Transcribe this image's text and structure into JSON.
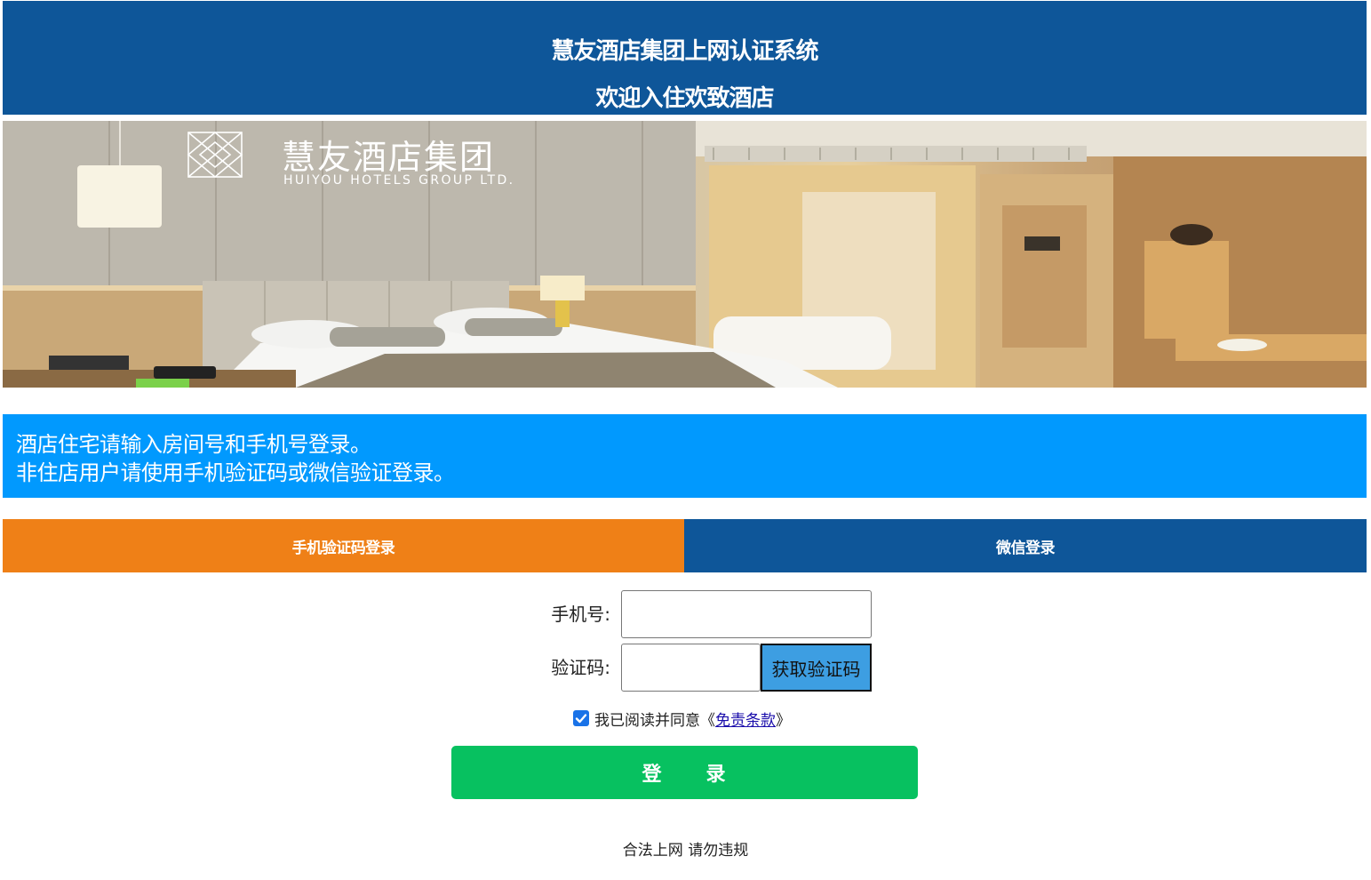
{
  "header": {
    "title": "慧友酒店集团上网认证系统",
    "subtitle": "欢迎入住欢致酒店"
  },
  "banner": {
    "brand_name": "慧友酒店集团",
    "brand_en": "HUIYOU HOTELS GROUP LTD."
  },
  "notice": {
    "line1": "酒店住宅请输入房间号和手机号登录。",
    "line2": "非住店用户请使用手机验证码或微信验证登录。"
  },
  "tabs": [
    {
      "label": "手机验证码登录",
      "active": true
    },
    {
      "label": "微信登录",
      "active": false
    }
  ],
  "form": {
    "phone_label": "手机号:",
    "phone_value": "",
    "code_label": "验证码:",
    "code_value": "",
    "get_code_label": "获取验证码",
    "agree_checked": true,
    "agree_text": "我已阅读并同意《",
    "agree_link": "免责条款",
    "agree_suffix": "》",
    "login_label": "登　　录"
  },
  "footer": "合法上网 请勿违规",
  "colors": {
    "header": "#0e5699",
    "notice": "#0199fe",
    "tab_active": "#ef8017",
    "tab_inactive": "#0e5699",
    "login": "#07c160",
    "code_button": "#3d9ee2"
  }
}
